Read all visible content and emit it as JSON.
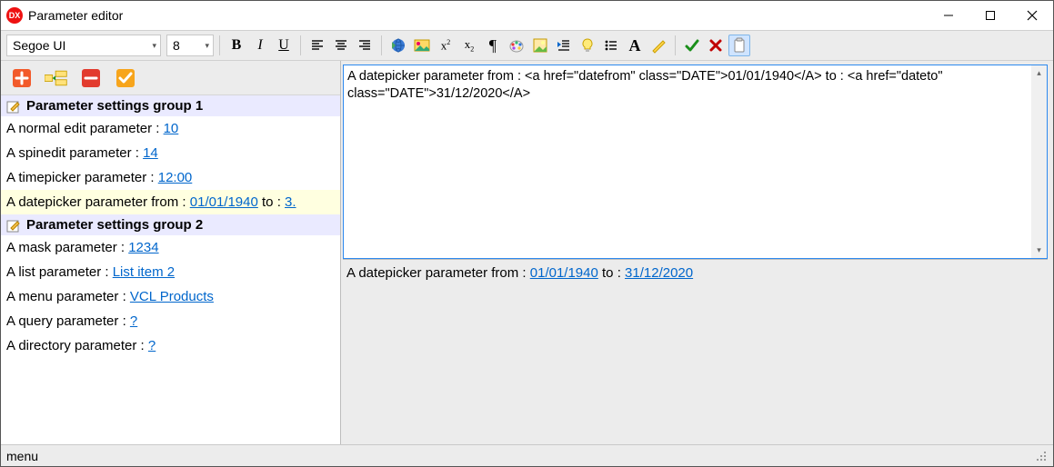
{
  "window": {
    "title": "Parameter editor"
  },
  "toolbar": {
    "font_name": "Segoe UI",
    "font_size": "8"
  },
  "left_toolbar": {},
  "groups": [
    {
      "title": "Parameter settings group 1",
      "items": [
        {
          "label": "A normal edit parameter : ",
          "value": "10"
        },
        {
          "label": "A spinedit parameter : ",
          "value": "14"
        },
        {
          "label": "A timepicker parameter : ",
          "value": "12:00"
        },
        {
          "label": "A datepicker parameter from : ",
          "value": "01/01/1940",
          "tail_label": " to : ",
          "tail_value": "3.",
          "selected": true
        }
      ]
    },
    {
      "title": "Parameter settings group 2",
      "items": [
        {
          "label": "A mask parameter : ",
          "value": "1234"
        },
        {
          "label": "A list parameter : ",
          "value": "List item 2"
        },
        {
          "label": "A menu parameter : ",
          "value": "VCL Products"
        },
        {
          "label": "A query parameter : ",
          "value": "?"
        },
        {
          "label": "A directory parameter : ",
          "value": "?"
        }
      ]
    }
  ],
  "editor": {
    "raw": "A datepicker parameter from : <a href=\"datefrom\" class=\"DATE\">01/01/1940</A> to : <a href=\"dateto\" class=\"DATE\">31/12/2020</A>"
  },
  "preview": {
    "pre_text": "A datepicker parameter from : ",
    "link1": "01/01/1940",
    "mid_text": " to : ",
    "link2": "31/12/2020"
  },
  "statusbar": {
    "text": "menu"
  }
}
